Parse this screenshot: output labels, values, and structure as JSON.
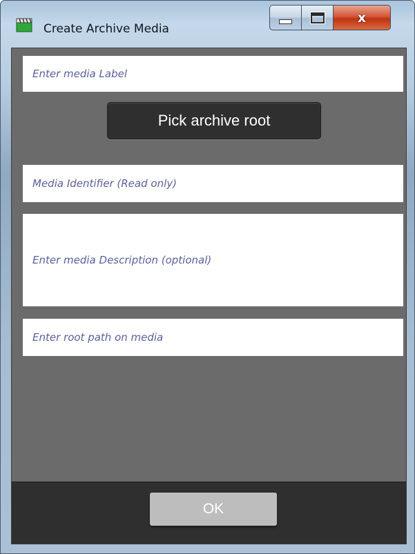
{
  "window": {
    "title": "Create Archive Media",
    "controls": {
      "minimize": "",
      "maximize": "",
      "close": "x"
    }
  },
  "form": {
    "label_placeholder": "Enter media Label",
    "pick_root_label": "Pick archive root",
    "identifier_placeholder": "Media Identifier (Read only)",
    "description_placeholder": "Enter media Description (optional)",
    "root_path_placeholder": "Enter root path on media"
  },
  "footer": {
    "ok_label": "OK"
  },
  "colors": {
    "client_bg": "#6b6b6b",
    "footer_bg": "#2f2f2f",
    "button_bg": "#2f2f2f",
    "ok_bg": "#bdbdbd",
    "placeholder_text": "#5a5f9a",
    "close_button": "#c8401c"
  },
  "icons": {
    "app": "clapperboard-icon"
  }
}
